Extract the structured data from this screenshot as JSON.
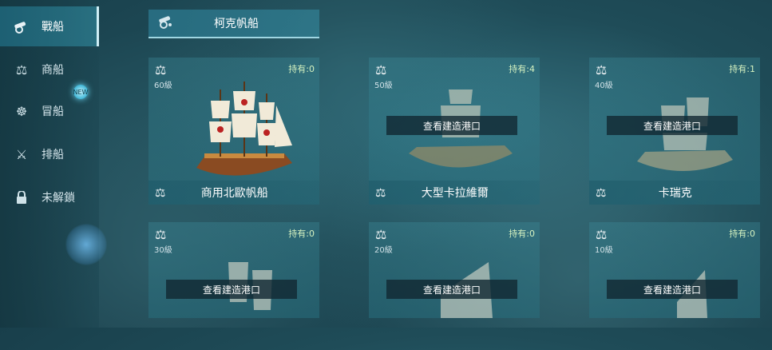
{
  "sidebar": {
    "items": [
      {
        "label": "戰船",
        "icon": "cannon-icon",
        "active": true
      },
      {
        "label": "商船",
        "icon": "scales-icon"
      },
      {
        "label": "冒船",
        "icon": "helm-icon",
        "badge": "NEW"
      },
      {
        "label": "排船",
        "icon": "crossed-swords-icon"
      },
      {
        "label": "未解鎖",
        "icon": "lock-icon"
      }
    ]
  },
  "section": {
    "title": "柯克帆船",
    "icon": "cannon-icon"
  },
  "cards": [
    {
      "level": "60級",
      "owned": "持有:0",
      "name": "商用北歐帆船",
      "port_button": ""
    },
    {
      "level": "50級",
      "owned": "持有:4",
      "name": "大型卡拉維爾",
      "port_button": "查看建造港口"
    },
    {
      "level": "40級",
      "owned": "持有:1",
      "name": "卡瑞克",
      "port_button": "查看建造港口"
    },
    {
      "level": "30級",
      "owned": "持有:0",
      "name": "",
      "port_button": "查看建造港口"
    },
    {
      "level": "20級",
      "owned": "持有:0",
      "name": "",
      "port_button": "查看建造港口"
    },
    {
      "level": "10級",
      "owned": "持有:0",
      "name": "",
      "port_button": "查看建造港口"
    }
  ]
}
